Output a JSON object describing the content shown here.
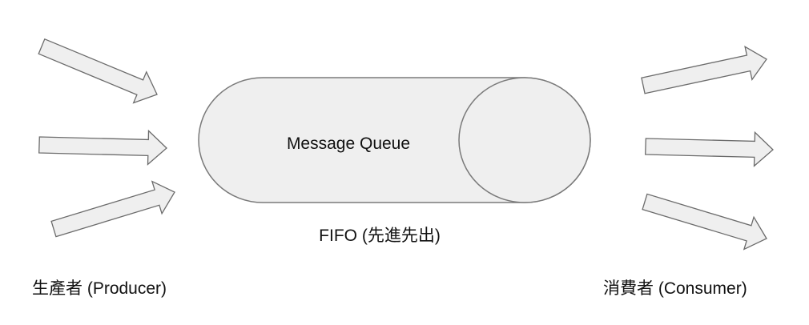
{
  "diagram": {
    "queue_label": "Message Queue",
    "fifo_label": "FIFO (先進先出)",
    "producer_label": "生產者 (Producer)",
    "consumer_label": "消費者 (Consumer)"
  },
  "colors": {
    "shape_fill": "#efefef",
    "stroke": "#7a7a7a",
    "text": "#111111"
  }
}
